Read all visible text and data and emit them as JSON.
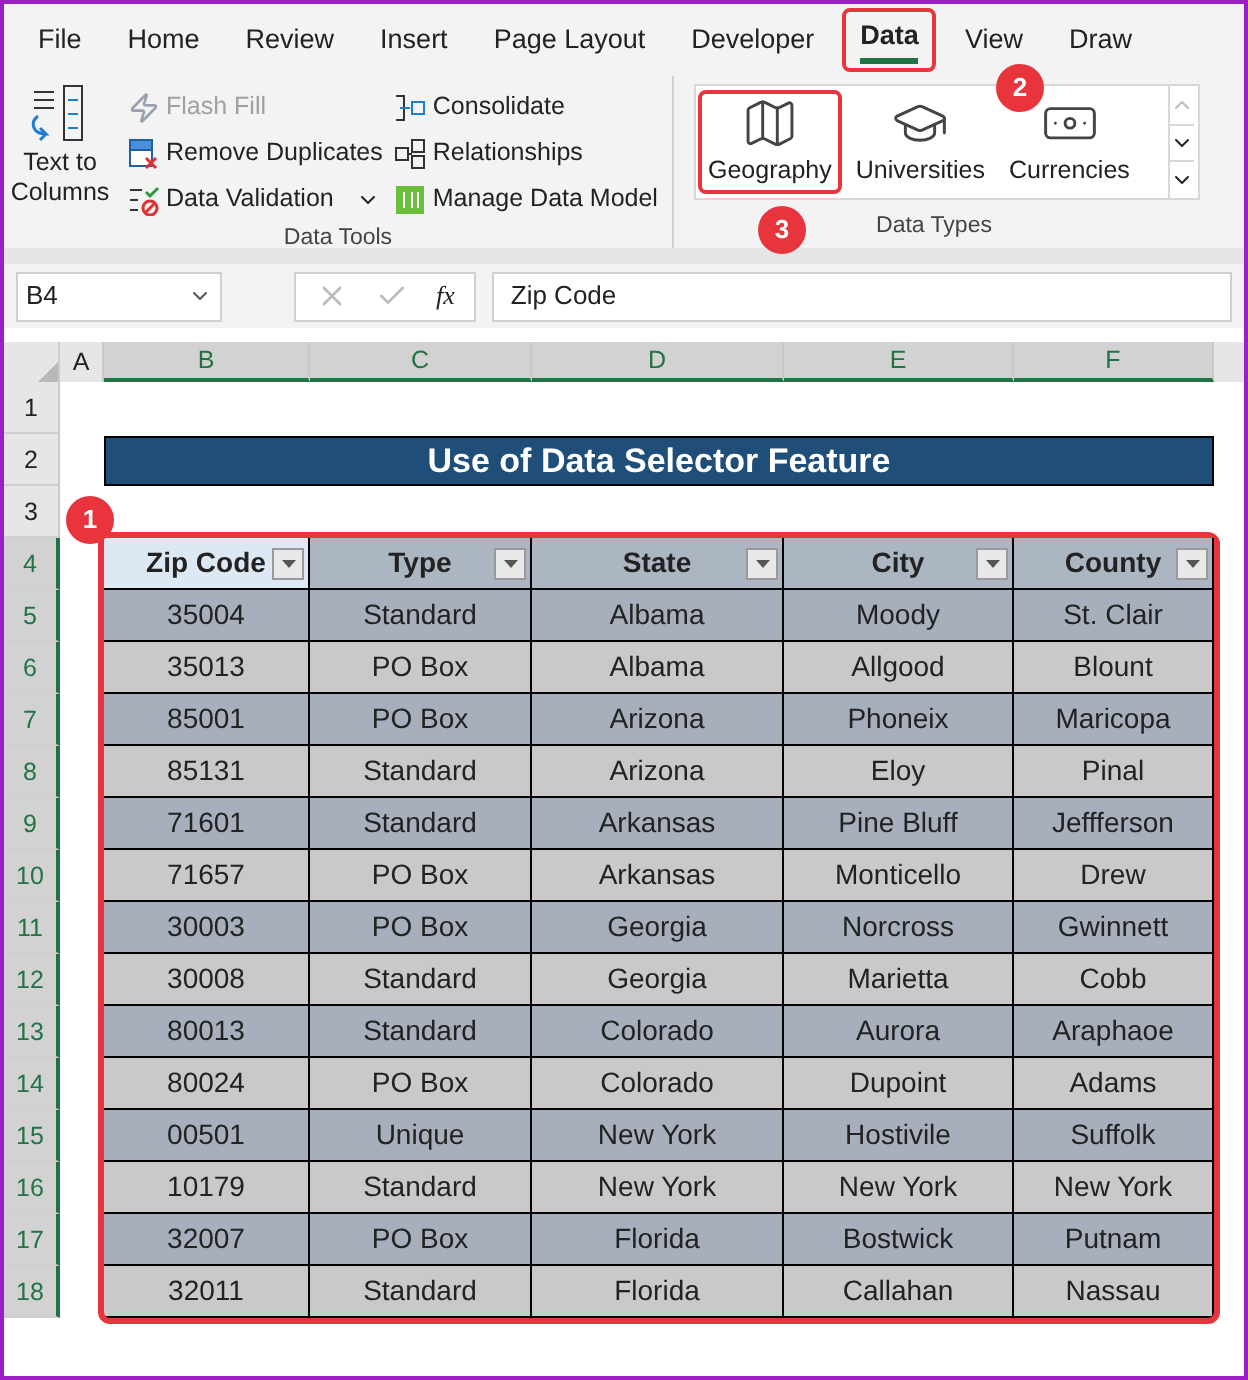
{
  "tabs": [
    {
      "label": "File",
      "selected": false,
      "highlighted": false
    },
    {
      "label": "Home",
      "selected": false,
      "highlighted": false
    },
    {
      "label": "Review",
      "selected": false,
      "highlighted": false
    },
    {
      "label": "Insert",
      "selected": false,
      "highlighted": false
    },
    {
      "label": "Page Layout",
      "selected": false,
      "highlighted": false
    },
    {
      "label": "Developer",
      "selected": false,
      "highlighted": false
    },
    {
      "label": "Data",
      "selected": true,
      "highlighted": true
    },
    {
      "label": "View",
      "selected": false,
      "highlighted": false
    },
    {
      "label": "Draw",
      "selected": false,
      "highlighted": false
    }
  ],
  "ribbon": {
    "data_tools": {
      "label": "Data Tools",
      "big_button": "Text to Columns",
      "commands": [
        {
          "kind": "flash",
          "label": "Flash Fill",
          "disabled": true,
          "dropdown": false
        },
        {
          "kind": "duplicates",
          "label": "Remove Duplicates",
          "disabled": false,
          "dropdown": false
        },
        {
          "kind": "validation",
          "label": "Data Validation",
          "disabled": false,
          "dropdown": true
        },
        {
          "kind": "consolidate",
          "label": "Consolidate",
          "disabled": false,
          "dropdown": false
        },
        {
          "kind": "relationships",
          "label": "Relationships",
          "disabled": false,
          "dropdown": false
        },
        {
          "kind": "model",
          "label": "Manage Data Model",
          "disabled": false,
          "dropdown": false
        }
      ]
    },
    "data_types": {
      "label": "Data Types",
      "items": [
        {
          "kind": "map",
          "label": "Geography",
          "highlighted": true
        },
        {
          "kind": "cap",
          "label": "Universities",
          "highlighted": false
        },
        {
          "kind": "money",
          "label": "Currencies",
          "highlighted": false
        }
      ]
    }
  },
  "formula_bar": {
    "name_box": "B4",
    "fx": "fx",
    "value": "Zip Code"
  },
  "sheet": {
    "columns": [
      {
        "label": "A",
        "selected": false
      },
      {
        "label": "B",
        "selected": true
      },
      {
        "label": "C",
        "selected": true
      },
      {
        "label": "D",
        "selected": true
      },
      {
        "label": "E",
        "selected": true
      },
      {
        "label": "F",
        "selected": true
      }
    ],
    "row_numbers": [
      {
        "label": "1",
        "selected": false
      },
      {
        "label": "2",
        "selected": false
      },
      {
        "label": "3",
        "selected": false
      },
      {
        "label": "4",
        "selected": true
      },
      {
        "label": "5",
        "selected": true
      },
      {
        "label": "6",
        "selected": true
      },
      {
        "label": "7",
        "selected": true
      },
      {
        "label": "8",
        "selected": true
      },
      {
        "label": "9",
        "selected": true
      },
      {
        "label": "10",
        "selected": true
      },
      {
        "label": "11",
        "selected": true
      },
      {
        "label": "12",
        "selected": true
      },
      {
        "label": "13",
        "selected": true
      },
      {
        "label": "14",
        "selected": true
      },
      {
        "label": "15",
        "selected": true
      },
      {
        "label": "16",
        "selected": true
      },
      {
        "label": "17",
        "selected": true
      },
      {
        "label": "18",
        "selected": true
      }
    ],
    "title": "Use of Data Selector Feature",
    "table": {
      "highlighted": true,
      "headers": [
        {
          "label": "Zip Code",
          "active": true
        },
        {
          "label": "Type",
          "active": false
        },
        {
          "label": "State",
          "active": false
        },
        {
          "label": "City",
          "active": false
        },
        {
          "label": "County",
          "active": false
        }
      ],
      "rows": [
        [
          "35004",
          "Standard",
          "Albama",
          "Moody",
          "St. Clair"
        ],
        [
          "35013",
          "PO Box",
          "Albama",
          "Allgood",
          "Blount"
        ],
        [
          "85001",
          "PO Box",
          "Arizona",
          "Phoneix",
          "Maricopa"
        ],
        [
          "85131",
          "Standard",
          "Arizona",
          "Eloy",
          "Pinal"
        ],
        [
          "71601",
          "Standard",
          "Arkansas",
          "Pine Bluff",
          "Jeffferson"
        ],
        [
          "71657",
          "PO Box",
          "Arkansas",
          "Monticello",
          "Drew"
        ],
        [
          "30003",
          "PO Box",
          "Georgia",
          "Norcross",
          "Gwinnett"
        ],
        [
          "30008",
          "Standard",
          "Georgia",
          "Marietta",
          "Cobb"
        ],
        [
          "80013",
          "Standard",
          "Colorado",
          "Aurora",
          "Araphaoe"
        ],
        [
          "80024",
          "PO Box",
          "Colorado",
          "Dupoint",
          "Adams"
        ],
        [
          "00501",
          "Unique",
          "New York",
          "Hostivile",
          "Suffolk"
        ],
        [
          "10179",
          "Standard",
          "New York",
          "New York",
          "New York"
        ],
        [
          "32007",
          "PO Box",
          "Florida",
          "Bostwick",
          "Putnam"
        ],
        [
          "32011",
          "Standard",
          "Florida",
          "Callahan",
          "Nassau"
        ]
      ]
    }
  },
  "callouts": [
    {
      "label": "1"
    },
    {
      "label": "2"
    },
    {
      "label": "3"
    }
  ]
}
